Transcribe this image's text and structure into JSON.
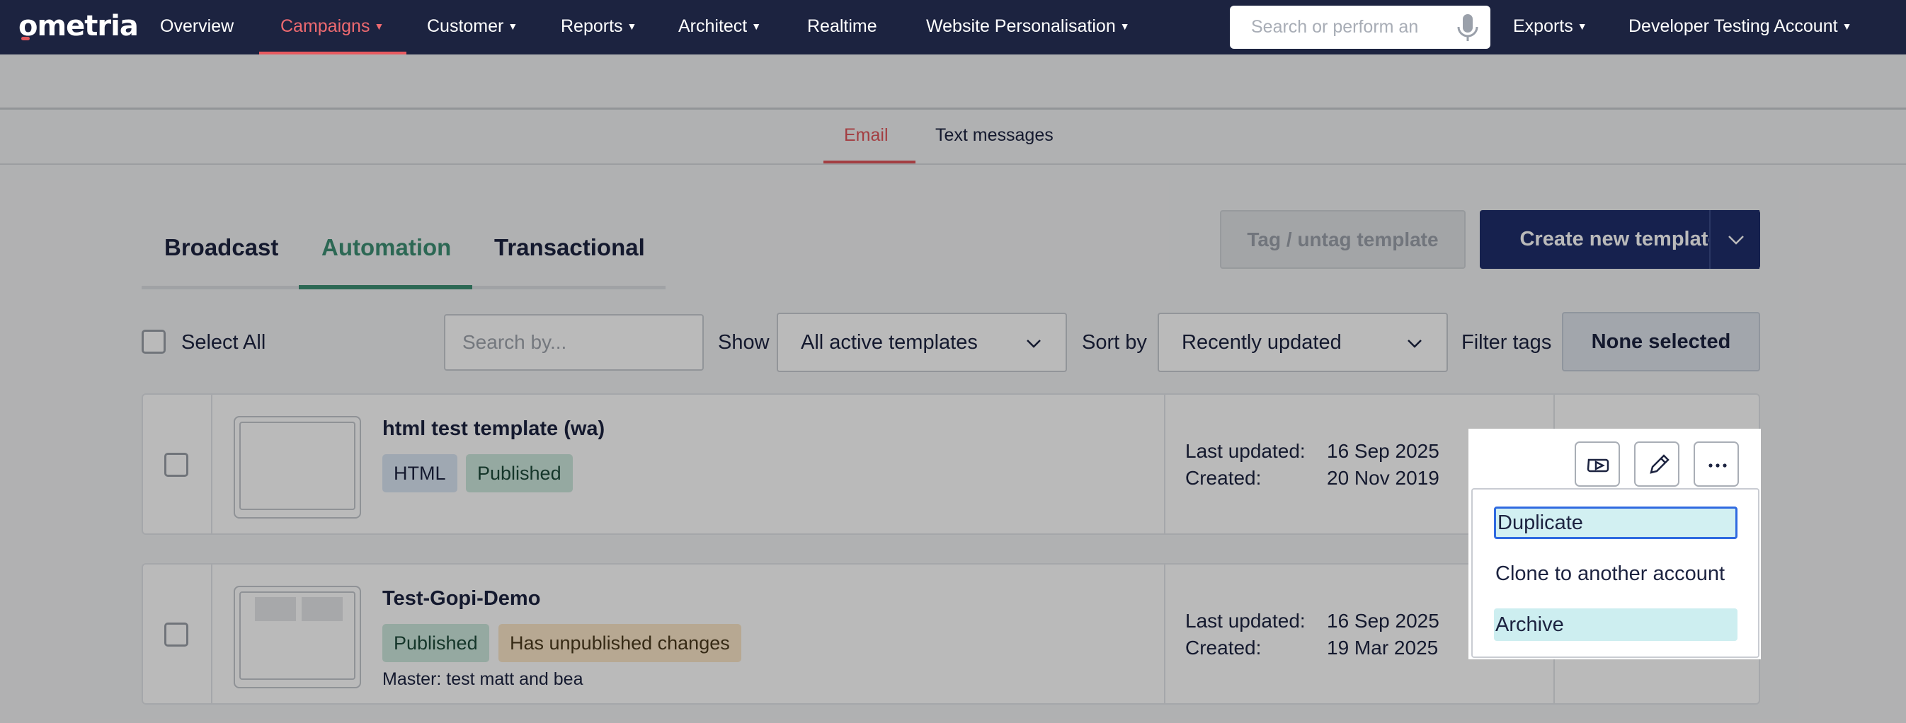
{
  "nav": {
    "logo": "ometria",
    "items": [
      {
        "label": "Overview",
        "caret": ""
      },
      {
        "label": "Campaigns",
        "caret": "▼"
      },
      {
        "label": "Customer",
        "caret": "▼"
      },
      {
        "label": "Reports",
        "caret": "▼"
      },
      {
        "label": "Architect",
        "caret": "▼"
      },
      {
        "label": "Realtime",
        "caret": ""
      },
      {
        "label": "Website Personalisation",
        "caret": "▼"
      }
    ],
    "search_placeholder": "Search or perform an",
    "exports": "Exports",
    "account": "Developer Testing Account",
    "active_color": "#ee6a70"
  },
  "channel_tabs": [
    "Email",
    "Text messages"
  ],
  "type_tabs": [
    "Broadcast",
    "Automation",
    "Transactional"
  ],
  "toolbar": {
    "tag_button": "Tag / untag template",
    "create_button": "Create new template"
  },
  "filters": {
    "select_all": "Select All",
    "search_placeholder": "Search by...",
    "show_label": "Show",
    "show_value": "All active templates",
    "sort_label": "Sort by",
    "sort_value": "Recently updated",
    "filter_tags_label": "Filter tags",
    "filter_tags_value": "None selected"
  },
  "templates": [
    {
      "name": "html test template (wa)",
      "badges": [
        "HTML",
        "Published"
      ],
      "last_updated_label": "Last updated:",
      "last_updated": "16 Sep 2025",
      "created_label": "Created:",
      "created": "20 Nov 2019"
    },
    {
      "name": "Test-Gopi-Demo",
      "badges": [
        "Published",
        "Has unpublished changes"
      ],
      "master": "Master: test matt and bea",
      "last_updated_label": "Last updated:",
      "last_updated": "16 Sep 2025",
      "created_label": "Created:",
      "created": "19 Mar 2025"
    }
  ],
  "action_menu": [
    "Duplicate",
    "Clone to another account",
    "Archive"
  ],
  "colors": {
    "nav_bg": "#1c2340",
    "primary": "#1f2e6b",
    "green": "#3d8f74",
    "red": "#e0565b"
  }
}
